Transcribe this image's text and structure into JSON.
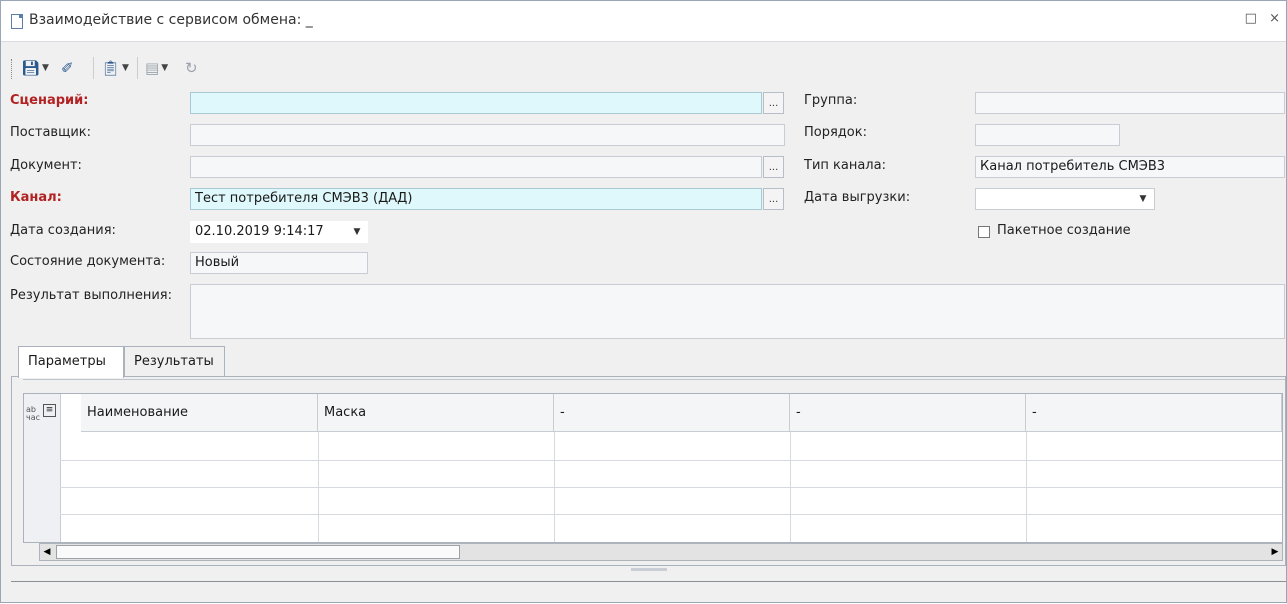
{
  "window": {
    "title": "Взаимодействие с сервисом обмена: _",
    "controls": [
      "□",
      "×"
    ]
  },
  "toolbar": {
    "save_icon": "floppy-disk-icon",
    "edit_icon": "eraser-icon",
    "copy_icon": "clipboard-icon",
    "doc_icon": "document-icon",
    "refresh_icon": "refresh-icon"
  },
  "form": {
    "scenario_label": "Сценарий:",
    "scenario_value": "",
    "supplier_label": "Поставщик:",
    "supplier_value": "",
    "document_label": "Документ:",
    "document_value": "",
    "channel_label": "Канал:",
    "channel_value": "Тест потребителя СМЭВ3 (ДАД)",
    "created_label": "Дата создания:",
    "created_value": "02.10.2019 9:14:17",
    "state_label": "Состояние документа:",
    "state_value": "Новый",
    "result_label": "Результат выполнения:",
    "result_value": "",
    "group_label": "Группа:",
    "group_value": "",
    "order_label": "Порядок:",
    "order_value": "",
    "channel_type_label": "Тип канала:",
    "channel_type_value": "Канал потребитель СМЭВ3",
    "export_date_label": "Дата выгрузки:",
    "export_date_value": "",
    "batch_label": "Пакетное создание",
    "batch_checked": false,
    "ellipsis": "..."
  },
  "tabs": [
    {
      "label": "Параметры",
      "active": true
    },
    {
      "label": "Результаты",
      "active": false
    }
  ],
  "grid": {
    "columns": [
      "Наименование",
      "Маска",
      "-",
      "-",
      "-"
    ],
    "row_count": 4
  },
  "colors": {
    "required_label": "#b22222",
    "required_field": "#dff8fb"
  }
}
